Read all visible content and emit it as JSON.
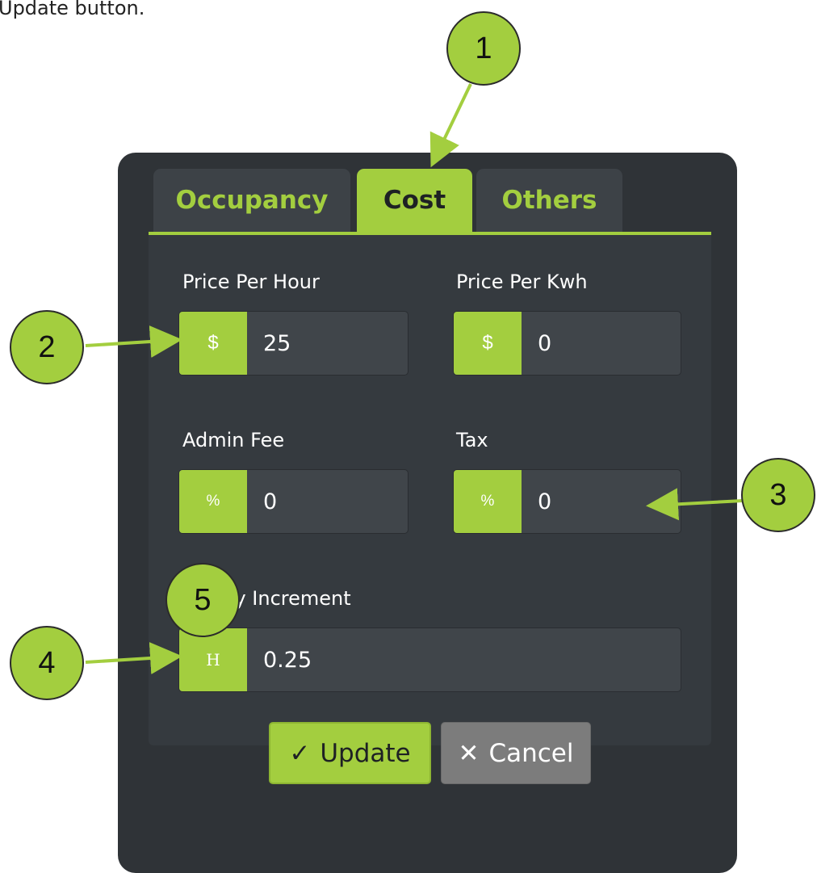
{
  "caption": "Update button.",
  "tabs": [
    {
      "label": "Occupancy",
      "active": false
    },
    {
      "label": "Cost",
      "active": true
    },
    {
      "label": "Others",
      "active": false
    }
  ],
  "fields": {
    "price_per_hour": {
      "label": "Price Per Hour",
      "prefix": "$",
      "value": "25"
    },
    "price_per_kwh": {
      "label": "Price Per Kwh",
      "prefix": "$",
      "value": "0"
    },
    "admin_fee": {
      "label": "Admin Fee",
      "prefix": "%",
      "value": "0"
    },
    "tax": {
      "label": "Tax",
      "prefix": "%",
      "value": "0"
    },
    "hourly_increment": {
      "label": "Hourly Increment",
      "prefix": "H",
      "value": "0.25"
    }
  },
  "buttons": {
    "update_icon": "✓",
    "update_label": "Update",
    "cancel_icon": "✕",
    "cancel_label": "Cancel"
  },
  "callouts": [
    "1",
    "2",
    "3",
    "4",
    "5"
  ],
  "colors": {
    "accent": "#a3ce3f",
    "panel": "#2f3337",
    "input_bg": "#40454a",
    "cancel": "#7c7c7c"
  }
}
